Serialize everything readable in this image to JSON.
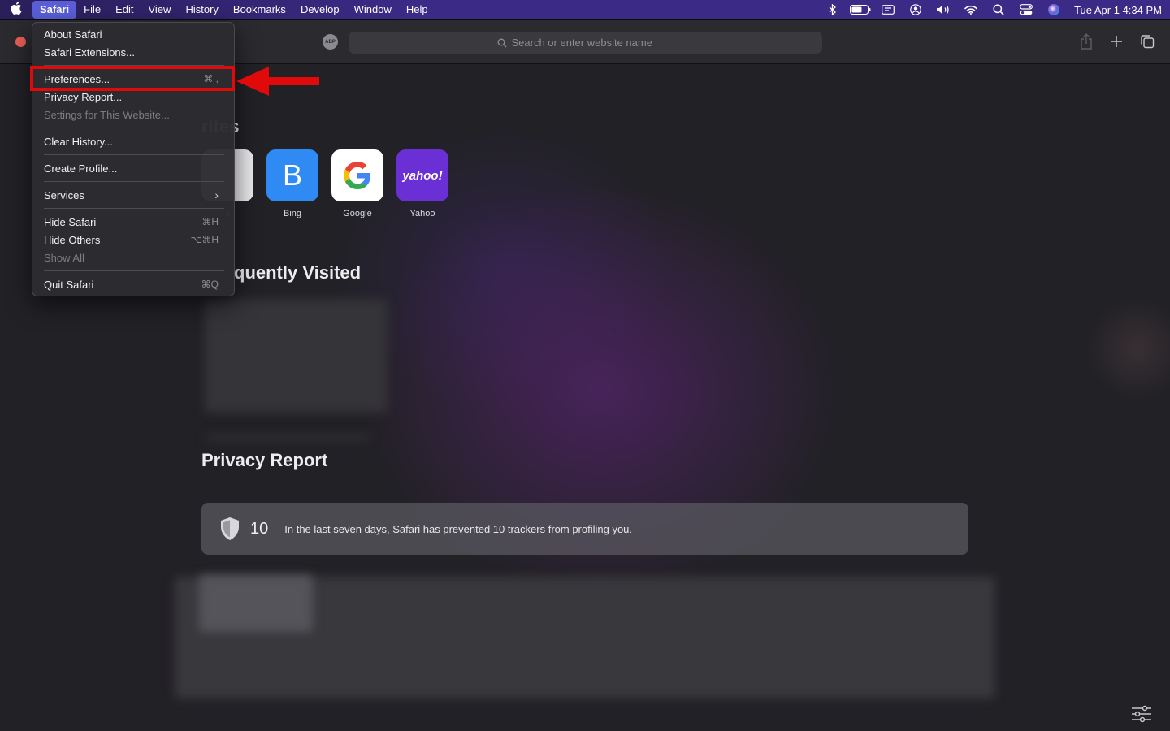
{
  "menubar": {
    "apple_icon": "apple-icon",
    "items": [
      "Safari",
      "File",
      "Edit",
      "View",
      "History",
      "Bookmarks",
      "Develop",
      "Window",
      "Help"
    ],
    "status_icons": [
      "bluetooth-icon",
      "battery-icon",
      "input-source-icon",
      "user-icon",
      "volume-icon",
      "wifi-icon",
      "search-icon",
      "control-center-icon",
      "siri-icon"
    ],
    "clock": "Tue Apr 1  4:34 PM"
  },
  "toolbar": {
    "extension_label": "ABP",
    "search_placeholder": "Search or enter website name"
  },
  "safari_menu": {
    "items": [
      {
        "label": "About Safari",
        "shortcut": "",
        "enabled": true
      },
      {
        "label": "Safari Extensions...",
        "shortcut": "",
        "enabled": true
      },
      {
        "label": "Preferences...",
        "shortcut": "⌘ ,",
        "enabled": true,
        "highlighted": true
      },
      {
        "label": "Privacy Report...",
        "shortcut": "",
        "enabled": true
      },
      {
        "label": "Settings for This Website...",
        "shortcut": "",
        "enabled": false
      },
      {
        "label": "Clear History...",
        "shortcut": "",
        "enabled": true
      },
      {
        "label": "Create Profile...",
        "shortcut": "",
        "enabled": true
      },
      {
        "label": "Services",
        "shortcut": "",
        "enabled": true,
        "submenu": true
      },
      {
        "label": "Hide Safari",
        "shortcut": "⌘H",
        "enabled": true
      },
      {
        "label": "Hide Others",
        "shortcut": "⌥⌘H",
        "enabled": true
      },
      {
        "label": "Show All",
        "shortcut": "",
        "enabled": false
      },
      {
        "label": "Quit Safari",
        "shortcut": "⌘Q",
        "enabled": true
      }
    ]
  },
  "start_page": {
    "favorites_title": "rites",
    "favorites": [
      {
        "label": "e",
        "glyph": ""
      },
      {
        "label": "Bing",
        "glyph": "B",
        "color": "#2f8bf3"
      },
      {
        "label": "Google",
        "glyph": "G",
        "color": "#ffffff"
      },
      {
        "label": "Yahoo",
        "glyph": "yahoo!",
        "color": "#6b2fd6"
      }
    ],
    "frequently_visited_title": "quently Visited",
    "privacy_title": "Privacy Report",
    "privacy_count": "10",
    "privacy_message": "In the last seven days, Safari has prevented 10 trackers from profiling you."
  },
  "colors": {
    "annotation_red": "#e00a0a",
    "menubar_accent": "#5a5fd8"
  }
}
